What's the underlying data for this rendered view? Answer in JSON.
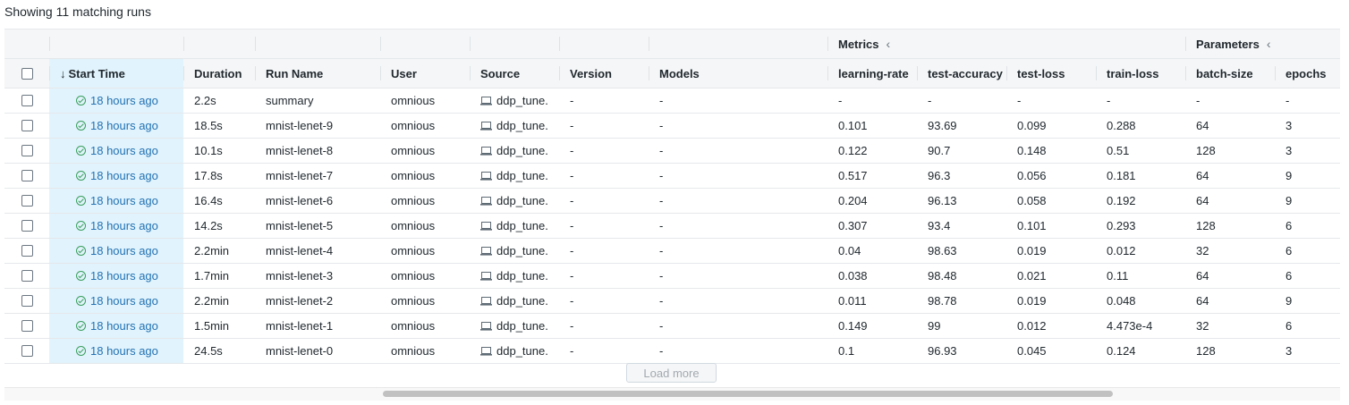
{
  "summary": "Showing 11 matching runs",
  "groups": {
    "metrics": "Metrics",
    "parameters": "Parameters"
  },
  "headers": {
    "start_time": "Start Time",
    "duration": "Duration",
    "run_name": "Run Name",
    "user": "User",
    "source": "Source",
    "version": "Version",
    "models": "Models",
    "learning_rate": "learning-rate",
    "test_accuracy": "test-accuracy",
    "test_loss": "test-loss",
    "train_loss": "train-loss",
    "batch_size": "batch-size",
    "epochs": "epochs"
  },
  "rows": [
    {
      "start": "18 hours ago",
      "duration": "2.2s",
      "name": "summary",
      "user": "omnious",
      "source": "ddp_tune.",
      "version": "-",
      "models": "-",
      "lr": "-",
      "acc": "-",
      "tloss": "-",
      "trloss": "-",
      "bs": "-",
      "ep": "-"
    },
    {
      "start": "18 hours ago",
      "duration": "18.5s",
      "name": "mnist-lenet-9",
      "user": "omnious",
      "source": "ddp_tune.",
      "version": "-",
      "models": "-",
      "lr": "0.101",
      "acc": "93.69",
      "tloss": "0.099",
      "trloss": "0.288",
      "bs": "64",
      "ep": "3"
    },
    {
      "start": "18 hours ago",
      "duration": "10.1s",
      "name": "mnist-lenet-8",
      "user": "omnious",
      "source": "ddp_tune.",
      "version": "-",
      "models": "-",
      "lr": "0.122",
      "acc": "90.7",
      "tloss": "0.148",
      "trloss": "0.51",
      "bs": "128",
      "ep": "3"
    },
    {
      "start": "18 hours ago",
      "duration": "17.8s",
      "name": "mnist-lenet-7",
      "user": "omnious",
      "source": "ddp_tune.",
      "version": "-",
      "models": "-",
      "lr": "0.517",
      "acc": "96.3",
      "tloss": "0.056",
      "trloss": "0.181",
      "bs": "64",
      "ep": "9"
    },
    {
      "start": "18 hours ago",
      "duration": "16.4s",
      "name": "mnist-lenet-6",
      "user": "omnious",
      "source": "ddp_tune.",
      "version": "-",
      "models": "-",
      "lr": "0.204",
      "acc": "96.13",
      "tloss": "0.058",
      "trloss": "0.192",
      "bs": "64",
      "ep": "9"
    },
    {
      "start": "18 hours ago",
      "duration": "14.2s",
      "name": "mnist-lenet-5",
      "user": "omnious",
      "source": "ddp_tune.",
      "version": "-",
      "models": "-",
      "lr": "0.307",
      "acc": "93.4",
      "tloss": "0.101",
      "trloss": "0.293",
      "bs": "128",
      "ep": "6"
    },
    {
      "start": "18 hours ago",
      "duration": "2.2min",
      "name": "mnist-lenet-4",
      "user": "omnious",
      "source": "ddp_tune.",
      "version": "-",
      "models": "-",
      "lr": "0.04",
      "acc": "98.63",
      "tloss": "0.019",
      "trloss": "0.012",
      "bs": "32",
      "ep": "6"
    },
    {
      "start": "18 hours ago",
      "duration": "1.7min",
      "name": "mnist-lenet-3",
      "user": "omnious",
      "source": "ddp_tune.",
      "version": "-",
      "models": "-",
      "lr": "0.038",
      "acc": "98.48",
      "tloss": "0.021",
      "trloss": "0.11",
      "bs": "64",
      "ep": "6"
    },
    {
      "start": "18 hours ago",
      "duration": "2.2min",
      "name": "mnist-lenet-2",
      "user": "omnious",
      "source": "ddp_tune.",
      "version": "-",
      "models": "-",
      "lr": "0.011",
      "acc": "98.78",
      "tloss": "0.019",
      "trloss": "0.048",
      "bs": "64",
      "ep": "9"
    },
    {
      "start": "18 hours ago",
      "duration": "1.5min",
      "name": "mnist-lenet-1",
      "user": "omnious",
      "source": "ddp_tune.",
      "version": "-",
      "models": "-",
      "lr": "0.149",
      "acc": "99",
      "tloss": "0.012",
      "trloss": "4.473e-4",
      "bs": "32",
      "ep": "6"
    },
    {
      "start": "18 hours ago",
      "duration": "24.5s",
      "name": "mnist-lenet-0",
      "user": "omnious",
      "source": "ddp_tune.",
      "version": "-",
      "models": "-",
      "lr": "0.1",
      "acc": "96.93",
      "tloss": "0.045",
      "trloss": "0.124",
      "bs": "128",
      "ep": "3"
    }
  ],
  "load_more": "Load more",
  "colors": {
    "accent": "#2272b4",
    "success": "#3a9e5d",
    "highlight": "#e1f3fc"
  }
}
